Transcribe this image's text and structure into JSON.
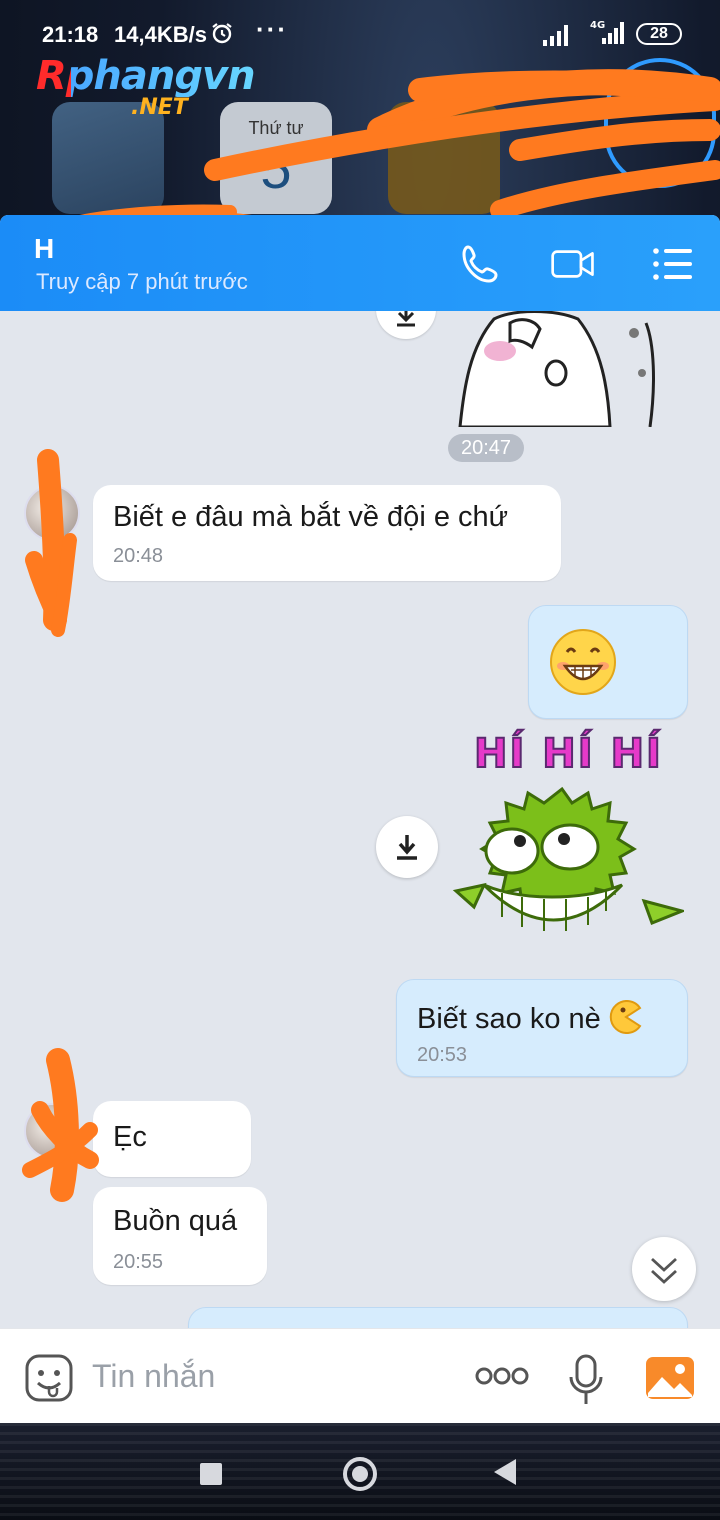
{
  "status_bar": {
    "time": "21:18",
    "net_speed": "14,4KB/s",
    "dots": "···",
    "network_type": "4G",
    "battery": "28"
  },
  "watermark": {
    "brand": "Rphangvn",
    "suffix": ".NET"
  },
  "home_screen": {
    "calendar_day": "Thứ tư",
    "calendar_date": "5"
  },
  "chat_header": {
    "contact_name": "H",
    "status": "Truy cập 7 phút trước",
    "icons": [
      "phone-icon",
      "video-camera-icon",
      "menu-list-icon"
    ]
  },
  "messages": [
    {
      "type": "sticker",
      "sender": "me",
      "sticker": "cat-sticker"
    },
    {
      "type": "time_divider",
      "text": "20:47"
    },
    {
      "type": "text",
      "sender": "contact",
      "text": "Biết e đâu mà bắt về đội e chứ",
      "time": "20:48"
    },
    {
      "type": "emoji",
      "sender": "me",
      "emoji": "grinning-face"
    },
    {
      "type": "sticker",
      "sender": "me",
      "caption": "HÍ HÍ HÍ",
      "sticker": "green-pufferfish"
    },
    {
      "type": "text",
      "sender": "me",
      "text": "Biết sao ko nè",
      "emoji": "pacman-emoji",
      "time": "20:53"
    },
    {
      "type": "text",
      "sender": "contact",
      "text": "Ẹc"
    },
    {
      "type": "text",
      "sender": "contact",
      "text": "Buồn quá",
      "time": "20:55"
    }
  ],
  "input_bar": {
    "placeholder": "Tin nhắn",
    "more_label": "ooo"
  },
  "colors": {
    "header_blue": "#1b8cf7",
    "chat_bg": "#e2e6ed",
    "my_bubble": "#d6ecfd",
    "redaction_orange": "#ff7a1f",
    "image_icon_orange": "#f88a2a"
  }
}
